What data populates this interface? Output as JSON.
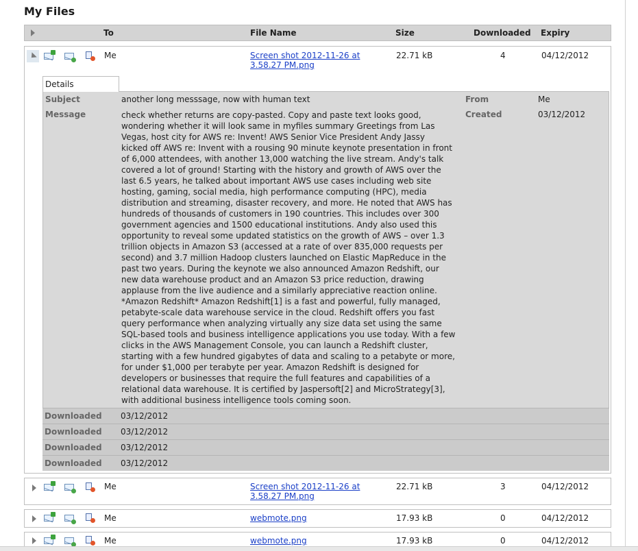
{
  "page_title": "My Files",
  "columns": {
    "to": "To",
    "file_name": "File Name",
    "size": "Size",
    "downloaded": "Downloaded",
    "expiry": "Expiry"
  },
  "expanded_row": {
    "to": "Me",
    "file_name_line1": "Screen shot 2012-11-26 at",
    "file_name_line2": "3.58.27 PM.png",
    "size": "22.71 kB",
    "downloaded": "4",
    "expiry": "04/12/2012"
  },
  "details": {
    "tab_label": "Details",
    "subject_label": "Subject",
    "subject": "another long messsage, now with human text",
    "from_label": "From",
    "from": "Me",
    "message_label": "Message",
    "created_label": "Created",
    "created": "03/12/2012",
    "message_lines": [
      "check whether returns are copy-pasted. Copy and paste text looks good,",
      "wondering whether it will look same in myfiles summary Greetings from Las",
      "Vegas, host city for AWS re: Invent! AWS Senior Vice President Andy Jassy",
      "kicked off AWS re: Invent with a rousing 90 minute keynote presentation in front",
      "of 6,000 attendees, with another 13,000 watching the live stream. Andy's talk",
      "covered a lot of ground! Starting with the history and growth of AWS over the",
      "last 6.5 years, he talked about important AWS use cases including web site",
      "hosting, gaming, social media, high performance computing (HPC), media",
      "distribution and streaming, disaster recovery, and more. He noted that AWS has",
      "hundreds of thousands of customers in 190 countries. This includes over 300",
      "government agencies and 1500 educational institutions. Andy also used this",
      "opportunity to reveal some updated statistics on the growth of AWS – over 1.3",
      "trillion objects in Amazon S3 (accessed at a rate of over 835,000 requests per",
      "second) and 3.7 million Hadoop clusters launched on Elastic MapReduce in the",
      "past two years. During the keynote we also announced Amazon Redshift, our",
      "new data warehouse product and an Amazon S3 price reduction, drawing",
      "applause from the live audience and a similarly appreciative reaction online.",
      "*Amazon Redshift* Amazon Redshift[1] is a fast and powerful, fully managed,",
      "petabyte-scale data warehouse service in the cloud. Redshift offers you fast",
      "query performance when analyzing virtually any size data set using the same",
      "SQL-based tools and business intelligence applications you use today. With a few",
      "clicks in the AWS Management Console, you can launch a Redshift cluster,",
      "starting with a few hundred gigabytes of data and scaling to a petabyte or more,",
      "for under $1,000 per terabyte per year. Amazon Redshift is designed for",
      "developers or businesses that require the full features and capabilities of a",
      "relational data warehouse. It is certified by Jaspersoft[2] and MicroStrategy[3],",
      "with additional business intelligence tools coming soon."
    ],
    "downloads": [
      {
        "label": "Downloaded",
        "date": "03/12/2012"
      },
      {
        "label": "Downloaded",
        "date": "03/12/2012"
      },
      {
        "label": "Downloaded",
        "date": "03/12/2012"
      },
      {
        "label": "Downloaded",
        "date": "03/12/2012"
      }
    ]
  },
  "rows": [
    {
      "to": "Me",
      "file_name_line1": "Screen shot 2012-11-26 at",
      "file_name_line2": "3.58.27 PM.png",
      "size": "22.71 kB",
      "downloaded": "3",
      "expiry": "04/12/2012"
    },
    {
      "to": "Me",
      "file_name_line1": "webmote.png",
      "file_name_line2": "",
      "size": "17.93 kB",
      "downloaded": "0",
      "expiry": "04/12/2012"
    },
    {
      "to": "Me",
      "file_name_line1": "webmote.png",
      "file_name_line2": "",
      "size": "17.93 kB",
      "downloaded": "0",
      "expiry": "04/12/2012"
    }
  ],
  "icons": {
    "forward": "forward-mail-icon",
    "add": "add-mail-icon",
    "delete": "delete-file-icon",
    "expand": "expand-arrow-icon",
    "collapse": "collapse-arrow-icon"
  }
}
